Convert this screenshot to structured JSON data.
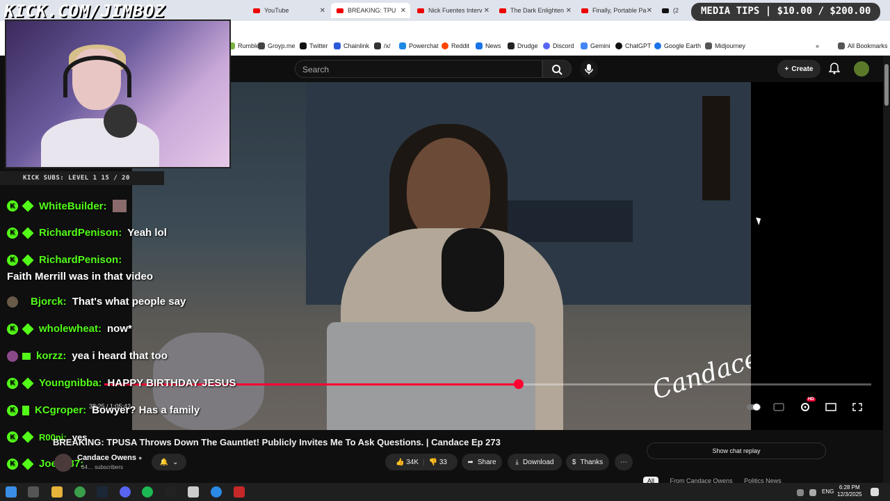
{
  "stream_brand": "KICK.COM/JIMBOZ",
  "media_tips": "MEDIA TIPS | $10.00 / $200.00",
  "kick_subs": "KICK SUBS: LEVEL 1 15 / 20",
  "browser": {
    "tabs": [
      {
        "label": "YouTube",
        "icon": "youtube-icon"
      },
      {
        "label": "BREAKING: TPU",
        "icon": "youtube-icon"
      },
      {
        "label": "Nick Fuentes Interv",
        "icon": "youtube-icon"
      },
      {
        "label": "The Dark Enlighten",
        "icon": "youtube-icon"
      },
      {
        "label": "Finally, Portable Pa",
        "icon": "youtube-icon"
      },
      {
        "label": "(2",
        "icon": "x-icon"
      }
    ],
    "bookmarks": [
      {
        "label": "Rumble",
        "color": "#7cb342"
      },
      {
        "label": "Groyp.me",
        "color": "#444444"
      },
      {
        "label": "Twitter",
        "color": "#111111"
      },
      {
        "label": "Chainlink",
        "color": "#2a5ada"
      },
      {
        "label": "/x/",
        "color": "#333333"
      },
      {
        "label": "Powerchat",
        "color": "#1e88e5"
      },
      {
        "label": "Reddit",
        "color": "#ff4500"
      },
      {
        "label": "News",
        "color": "#1a73e8"
      },
      {
        "label": "Drudge",
        "color": "#222222"
      },
      {
        "label": "Discord",
        "color": "#5865f2"
      },
      {
        "label": "Gemini",
        "color": "#4285f4"
      },
      {
        "label": "ChatGPT",
        "color": "#111111"
      },
      {
        "label": "Google Earth",
        "color": "#1a73e8"
      },
      {
        "label": "Midjourney",
        "color": "#555555"
      }
    ],
    "all_bookmarks": "All Bookmarks"
  },
  "youtube": {
    "search_placeholder": "Search",
    "create_label": "Create",
    "video_title": "BREAKING: TPUSA Throws Down The Gauntlet! Publicly Invites Me To Ask Questions. | Candace Ep 273",
    "channel_name": "Candace Owens",
    "subscribers": "64… subscribers",
    "likes": "34K",
    "dislikes": "33",
    "share_label": "Share",
    "download_label": "Download",
    "thanks_label": "Thanks",
    "show_chat_replay": "Show chat replay",
    "chips": [
      "All",
      "From Candace Owens",
      "Politics News"
    ],
    "time_display": "38:25 / 1:05:42",
    "progress_fraction": 0.54,
    "hd_badge": "HD",
    "video_signature": "Candace"
  },
  "chat": [
    {
      "user": "WhiteBuilder:",
      "message": ""
    },
    {
      "user": "RichardPenison:",
      "message": "Yeah lol"
    },
    {
      "user": "RichardPenison:",
      "message": "Faith Merrill was in that video"
    },
    {
      "user": "Bjorck:",
      "message": "That's what people say"
    },
    {
      "user": "wholewheat:",
      "message": "now*"
    },
    {
      "user": "korzz:",
      "message": "yea i heard that too"
    },
    {
      "user": "Youngnibba:",
      "message": "HAPPY BIRTHDAY JESUS"
    },
    {
      "user": "KCgroper:",
      "message": "Bowyer? Has a family"
    },
    {
      "user": "R00ni:",
      "message": "yes"
    },
    {
      "user": "Joey387:",
      "message": ""
    }
  ],
  "taskbar": {
    "lang": "ENG",
    "time": "6:28 PM",
    "date": "12/3/2025"
  }
}
